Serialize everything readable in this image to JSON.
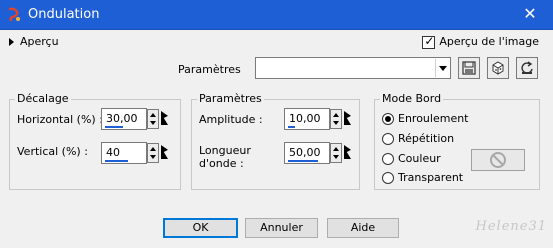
{
  "window": {
    "title": "Ondulation",
    "close_glyph": "✕",
    "title_bar_color": "#1f5fd6"
  },
  "preview": {
    "toggle_label": "Aperçu",
    "show_image_label": "Aperçu de l'image",
    "show_image_checked": true
  },
  "presets": {
    "label": "Paramètres",
    "value": ""
  },
  "offset_group": {
    "title": "Décalage",
    "horizontal_label": "Horizontal (%) :",
    "horizontal_value": "30,00",
    "vertical_label": "Vertical (%) :",
    "vertical_value": "40"
  },
  "params_group": {
    "title": "Paramètres",
    "amplitude_label": "Amplitude :",
    "amplitude_value": "10,00",
    "wavelength_label_line1": "Longueur",
    "wavelength_label_line2": "d'onde :",
    "wavelength_value": "50,00"
  },
  "edge_group": {
    "title": "Mode Bord",
    "options": [
      "Enroulement",
      "Répétition",
      "Couleur",
      "Transparent"
    ],
    "selected": "Enroulement"
  },
  "buttons": {
    "ok": "OK",
    "cancel": "Annuler",
    "help": "Aide"
  },
  "icons": [
    "app-icon",
    "close-icon",
    "expand-arrow-icon",
    "dropdown-arrow-icon",
    "save-preset-icon",
    "randomize-icon",
    "reset-icon",
    "spinner-arrows-icon",
    "no-color-icon"
  ],
  "accent_color": "#0078d7",
  "watermark": "Helene31"
}
